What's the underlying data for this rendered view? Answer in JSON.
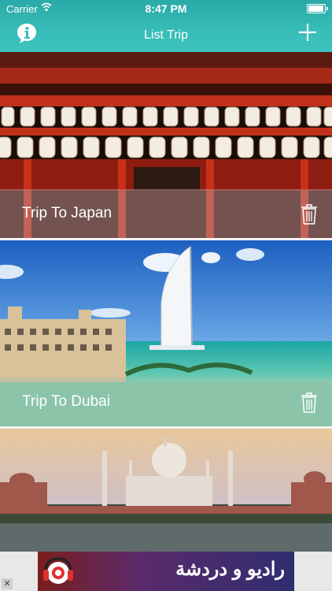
{
  "status_bar": {
    "carrier": "Carrier",
    "time": "8:47 PM"
  },
  "nav": {
    "title": "List Trip"
  },
  "trips": [
    {
      "label": "Trip To Japan"
    },
    {
      "label": "Trip To Dubai"
    }
  ],
  "ad": {
    "text": "راديو و دردشة"
  },
  "colors": {
    "nav_teal": "#38bdb8",
    "text_white": "#ffffff"
  }
}
